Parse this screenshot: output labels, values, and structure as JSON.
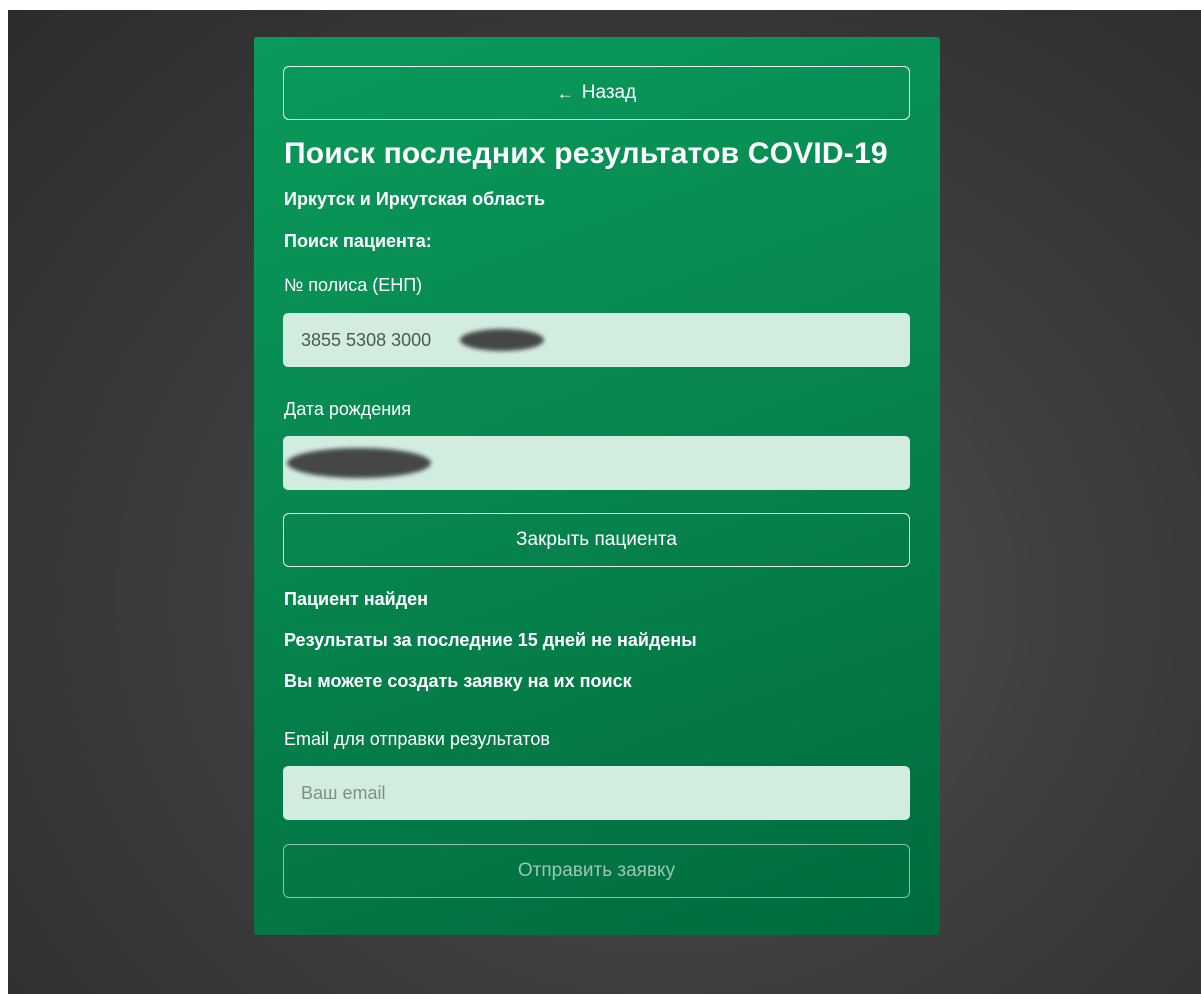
{
  "back_button": {
    "label": "Назад",
    "icon": "arrow-left-icon"
  },
  "title": "Поиск последних результатов COVID-19",
  "region": "Иркутск и Иркутская область",
  "patient_search_heading": "Поиск пациента:",
  "policy": {
    "label": "№ полиса (ЕНП)",
    "value": "3855 5308 3000"
  },
  "birth_date": {
    "label": "Дата рождения",
    "value": ""
  },
  "close_patient_button": {
    "label": "Закрыть пациента"
  },
  "status": {
    "found": "Пациент найден",
    "no_results": "Результаты за последние 15 дней не найдены",
    "can_request": "Вы можете создать заявку на их поиск"
  },
  "email": {
    "label": "Email для отправки результатов",
    "placeholder": "Ваш email"
  },
  "submit_button": {
    "label": "Отправить заявку"
  },
  "colors": {
    "card_green": "#07874f",
    "input_bg": "#d2ece0",
    "backdrop": "#3e3e3e"
  }
}
